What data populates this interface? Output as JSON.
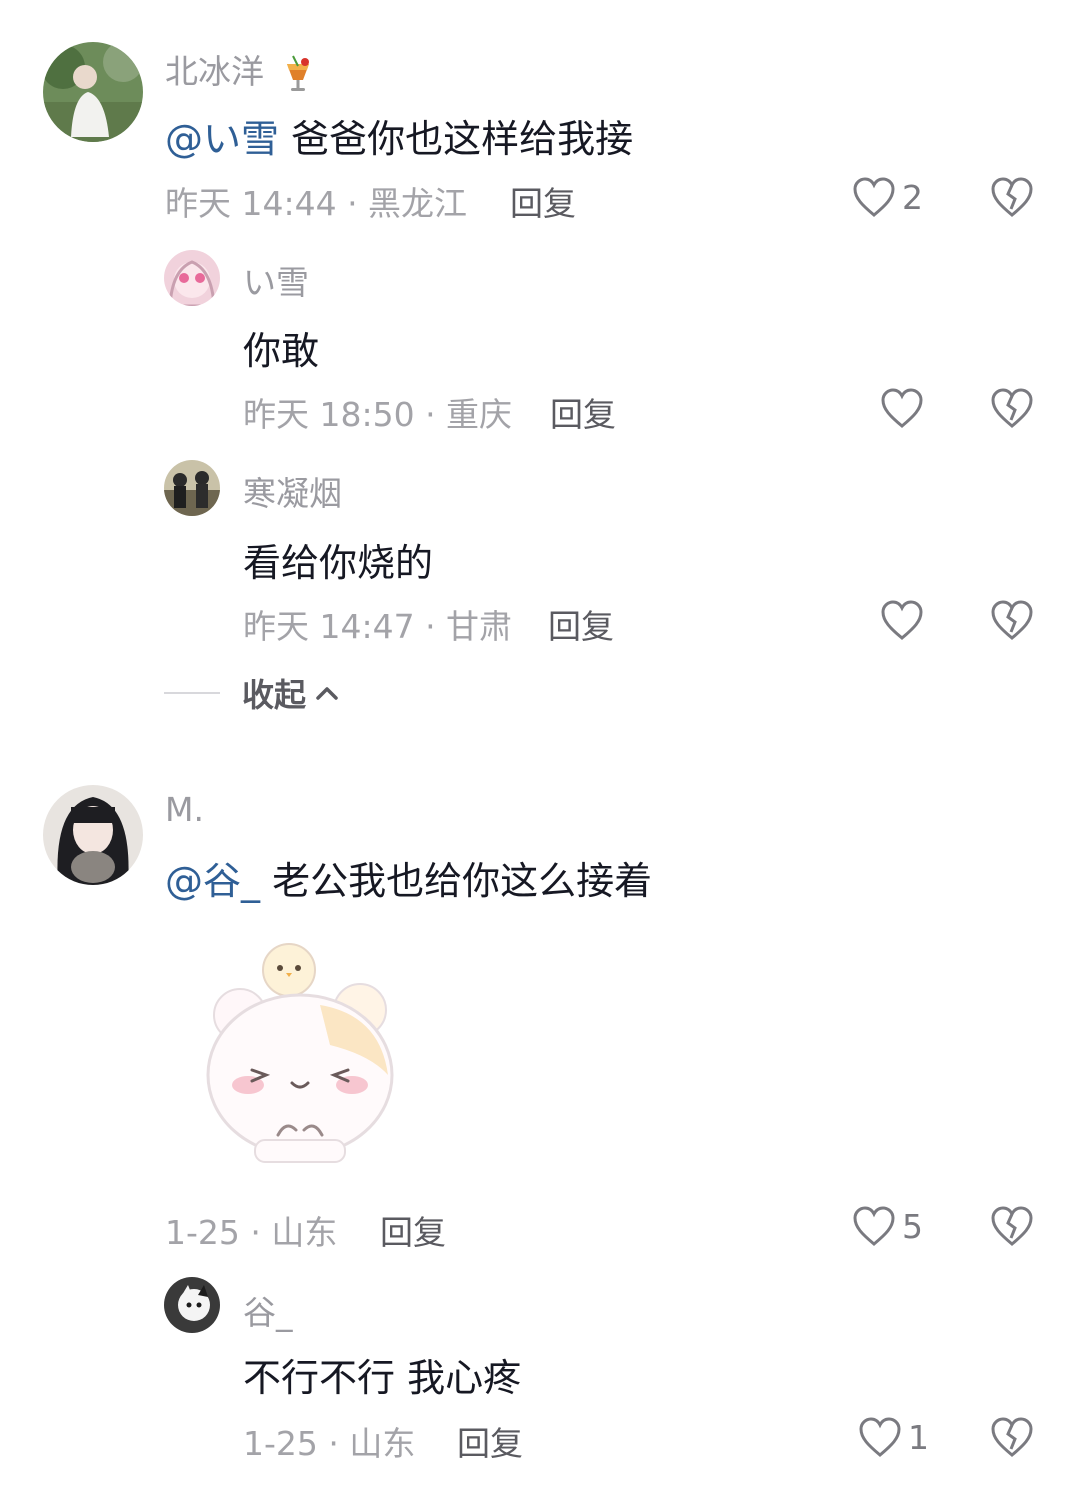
{
  "comments": [
    {
      "username": "北冰洋",
      "mention": "@い雪",
      "text": "爸爸你也这样给我接",
      "meta": "昨天 14:44 · 黑龙江",
      "reply_label": "回复",
      "likes": "2"
    },
    {
      "username": "い雪",
      "text": "你敢",
      "meta": "昨天 18:50 · 重庆",
      "reply_label": "回复"
    },
    {
      "username": "寒凝烟",
      "text": "看给你烧的",
      "meta": "昨天 14:47 · 甘肃",
      "reply_label": "回复"
    },
    {
      "username": "M.",
      "mention": "@谷_",
      "text": "老公我也给你这么接着",
      "meta": "1-25 · 山东",
      "reply_label": "回复",
      "likes": "5"
    },
    {
      "username": "谷_",
      "text": "不行不行 我心疼",
      "meta": "1-25 · 山东",
      "reply_label": "回复",
      "likes": "1"
    }
  ],
  "collapse_label": "收起",
  "icons": {
    "like": "heart-icon",
    "dislike": "broken-heart-icon",
    "collapse": "chevron-up-icon",
    "username_badge": "cocktail-icon"
  },
  "colors": {
    "mention": "#2f5f96",
    "meta": "#a3a3a8",
    "text": "#161823"
  }
}
